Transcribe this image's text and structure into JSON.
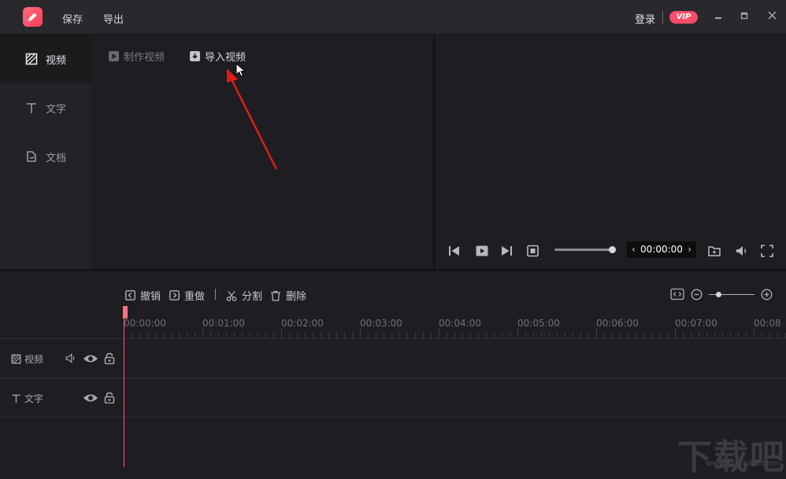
{
  "titlebar": {
    "menu": [
      "保存",
      "导出"
    ],
    "login_label": "登录",
    "vip_label": "VIP",
    "window_buttons": [
      "minimize",
      "maximize",
      "close"
    ]
  },
  "sidebar": {
    "items": [
      {
        "label": "视频",
        "icon": "video-icon",
        "active": true
      },
      {
        "label": "文字",
        "icon": "text-icon",
        "active": false
      },
      {
        "label": "文档",
        "icon": "document-icon",
        "active": false
      }
    ]
  },
  "media": {
    "tabs": [
      {
        "label": "制作视频",
        "icon": "make-video-icon"
      },
      {
        "label": "导入视频",
        "icon": "import-video-icon"
      }
    ]
  },
  "player": {
    "time": "00:00:00",
    "progress": 1.0
  },
  "timeline_toolbar": {
    "undo_label": "撤销",
    "redo_label": "重做",
    "split_label": "分割",
    "delete_label": "删除"
  },
  "ruler": {
    "ticks": [
      "00:00:00",
      "00:01:00",
      "00:02:00",
      "00:03:00",
      "00:04:00",
      "00:05:00",
      "00:06:00",
      "00:07:00",
      "00:08"
    ]
  },
  "tracks": [
    {
      "label": "视频",
      "icon": "video-icon"
    },
    {
      "label": "文字",
      "icon": "text-icon"
    }
  ],
  "watermark": {
    "main": "下载吧",
    "sub": "www.xiazaiba.com"
  },
  "colors": {
    "accent": "#ff4d67",
    "playhead": "#ff5a6e",
    "background": "#1e1e22"
  }
}
